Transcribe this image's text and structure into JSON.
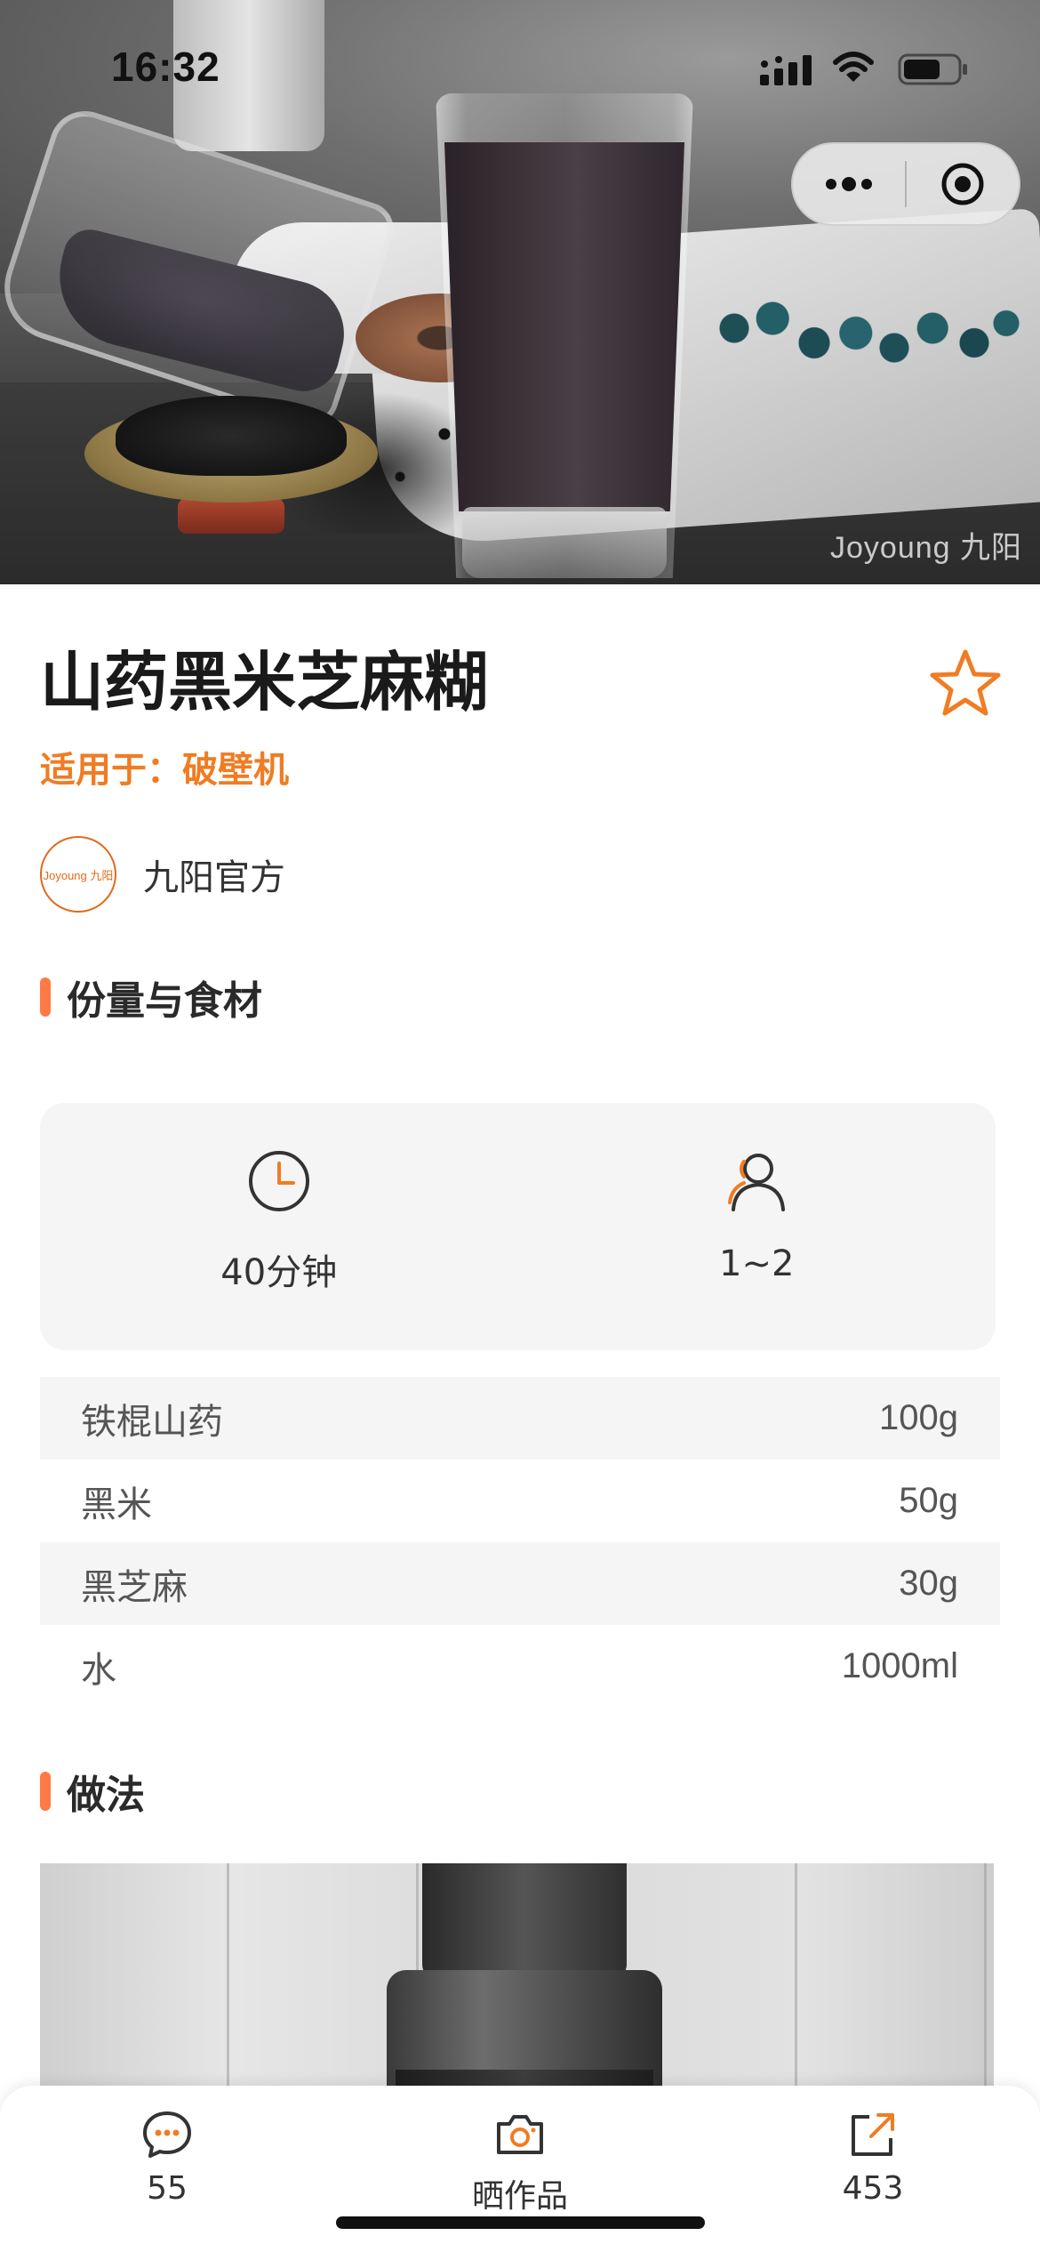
{
  "status_bar": {
    "time": "16:32"
  },
  "hero": {
    "watermark": "Joyoung 九阳"
  },
  "recipe": {
    "title": "山药黑米芝麻糊",
    "applies_to": "适用于：破壁机",
    "author_name": "九阳官方",
    "author_avatar_text": "Joyoung 九阳"
  },
  "sections": {
    "ingredients_header": "份量与食材",
    "method_header": "做法"
  },
  "info": {
    "time": "40分钟",
    "servings": "1~2"
  },
  "ingredients": [
    {
      "name": "铁棍山药",
      "qty": "100g"
    },
    {
      "name": "黑米",
      "qty": "50g"
    },
    {
      "name": "黑芝麻",
      "qty": "30g"
    },
    {
      "name": "水",
      "qty": "1000ml"
    }
  ],
  "bottom_bar": {
    "comments_count": "55",
    "share_works_label": "晒作品",
    "shares_count": "453"
  },
  "colors": {
    "accent": "#f07c23",
    "section_bar": "#ff7a45",
    "card_bg": "#f5f5f5"
  },
  "icons": [
    "signal-icon",
    "wifi-icon",
    "battery-icon",
    "more-icon",
    "close-target-icon",
    "star-icon",
    "clock-icon",
    "person-icon",
    "comment-icon",
    "camera-icon",
    "share-icon"
  ]
}
